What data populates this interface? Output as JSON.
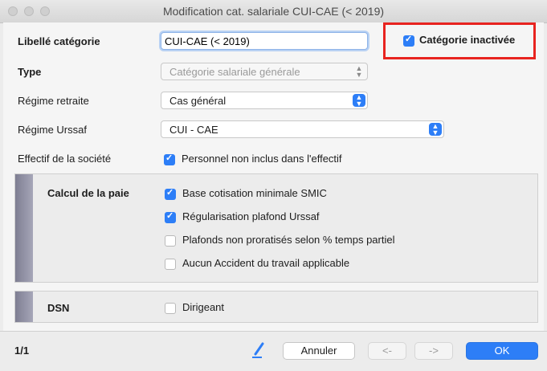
{
  "window": {
    "title": "Modification cat. salariale CUI-CAE (< 2019)"
  },
  "form": {
    "libelle_label": "Libellé catégorie",
    "libelle_value": "CUI-CAE (< 2019)",
    "inactive_label": "Catégorie inactivée",
    "inactive_checked": true,
    "type_label": "Type",
    "type_value": "Catégorie salariale générale",
    "retraite_label": "Régime retraite",
    "retraite_value": "Cas général",
    "urssaf_label": "Régime Urssaf",
    "urssaf_value": "CUI - CAE",
    "effectif_label": "Effectif de la société",
    "effectif_option": "Personnel non inclus dans l'effectif"
  },
  "paie": {
    "label": "Calcul de la paie",
    "options": [
      {
        "label": "Base cotisation minimale SMIC",
        "checked": true
      },
      {
        "label": "Régularisation plafond Urssaf",
        "checked": true
      },
      {
        "label": "Plafonds non proratisés selon % temps partiel",
        "checked": false
      },
      {
        "label": "Aucun Accident du travail applicable",
        "checked": false
      }
    ]
  },
  "dsn": {
    "label": "DSN",
    "option": "Dirigeant",
    "checked": false
  },
  "footer": {
    "page": "1/1",
    "cancel": "Annuler",
    "prev": "<-",
    "next": "->",
    "ok": "OK"
  },
  "colors": {
    "accent": "#2d7ef7",
    "highlight": "#e8231f"
  }
}
